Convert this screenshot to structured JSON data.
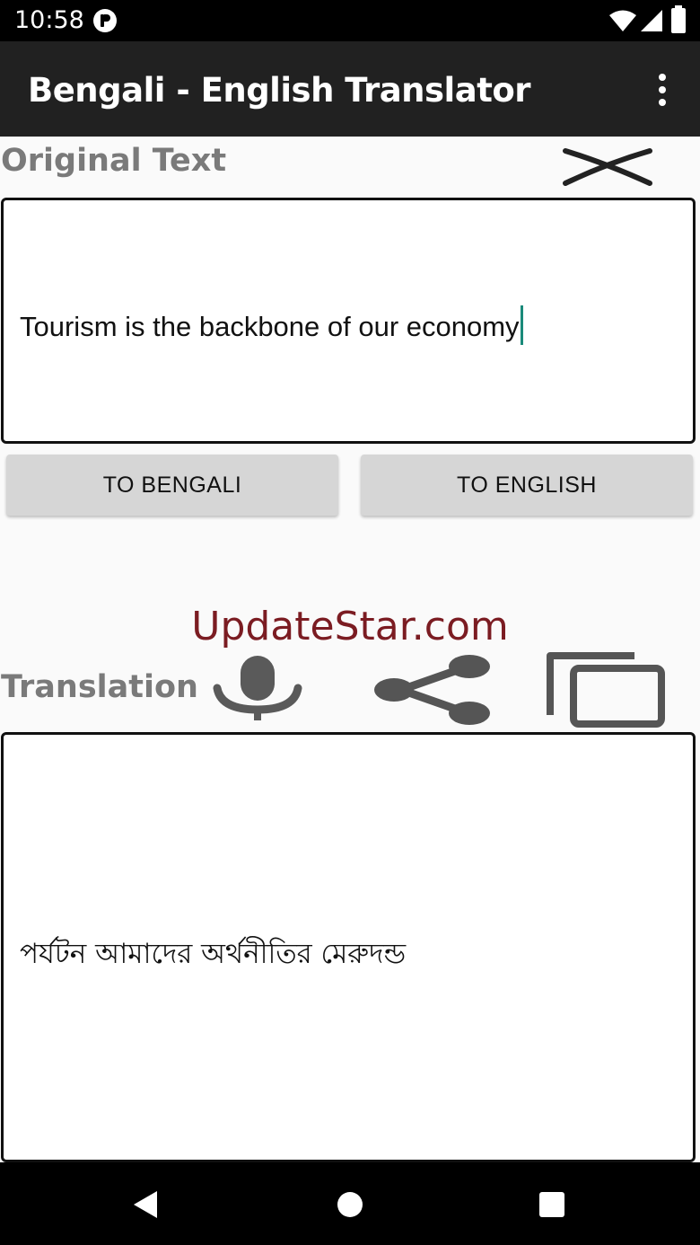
{
  "status_bar": {
    "time": "10:58"
  },
  "app_bar": {
    "title": "Bengali - English Translator",
    "menu_icon": "more-vert-icon"
  },
  "original": {
    "label": "Original Text",
    "clear_icon": "close-icon",
    "input_value": "Tourism is the backbone of our economy"
  },
  "buttons": {
    "to_bengali": "TO BENGALI",
    "to_english": "TO ENGLISH"
  },
  "watermark": "UpdateStar.com",
  "translation": {
    "label": "Translation",
    "icons": [
      "mic-icon",
      "share-icon",
      "copy-icon"
    ],
    "output_value": "পর্যটন আমাদের অর্থনীতির মেরুদন্ড"
  },
  "nav_bar": {
    "icons": [
      "back-icon",
      "home-icon",
      "recents-icon"
    ]
  },
  "colors": {
    "app_bar": "#212121",
    "label_gray": "#7a7a7a",
    "button_bg": "#d6d6d6",
    "watermark": "#7b1c22",
    "caret": "#1a8a7a"
  }
}
